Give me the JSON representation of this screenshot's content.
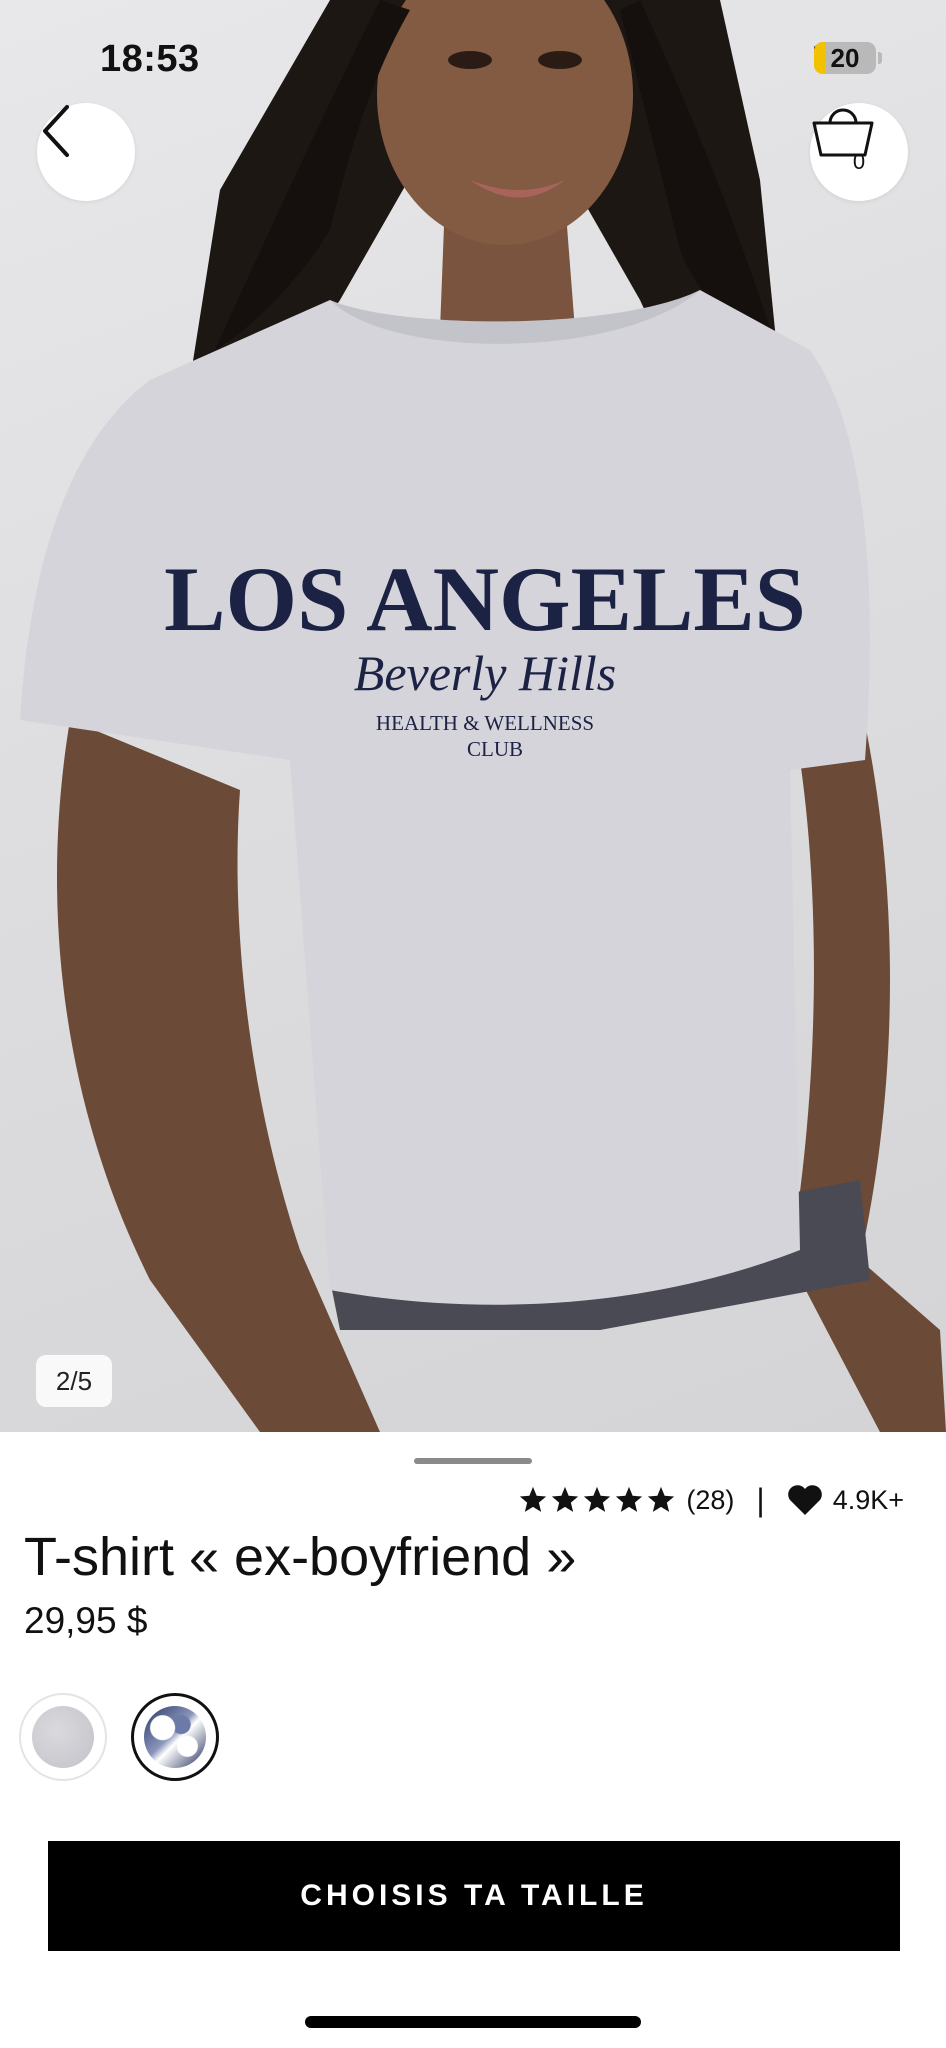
{
  "status_bar": {
    "time": "18:53",
    "battery_level": "20",
    "battery_fill": 0.2
  },
  "header": {
    "cart_count": "0"
  },
  "gallery": {
    "counter": "2/5",
    "shirt_print": {
      "line1": "LOS ANGELES",
      "line2": "Beverly Hills",
      "line3": "HEALTH & WELLNESS",
      "line4": "CLUB"
    }
  },
  "product": {
    "rating_stars": 5,
    "rating_count": "(28)",
    "separator": "|",
    "likes": "4.9K+",
    "title": "T-shirt « ex-boyfriend »",
    "price": "29,95 $"
  },
  "swatches": [
    {
      "name": "grey",
      "color": "#cfcfd4",
      "selected": false
    },
    {
      "name": "tie-dye navy",
      "color": "#2a3766",
      "selected": true
    }
  ],
  "cta": {
    "label": "CHOISIS TA TAILLE"
  },
  "colors": {
    "cta_bg": "#000000",
    "cta_text": "#ffffff"
  }
}
